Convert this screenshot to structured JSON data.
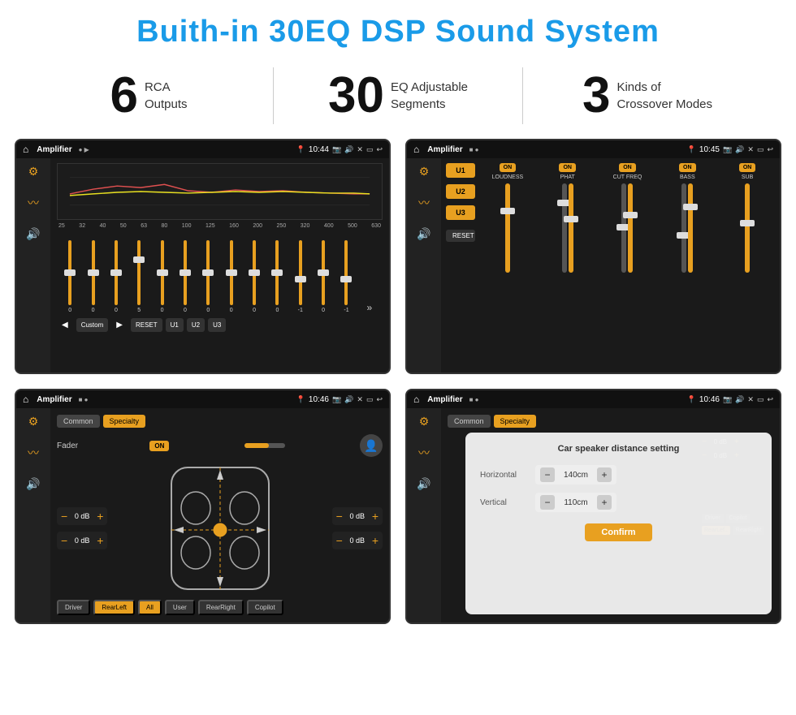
{
  "page": {
    "title": "Buith-in 30EQ DSP Sound System"
  },
  "stats": [
    {
      "number": "6",
      "label": "RCA\nOutputs"
    },
    {
      "number": "30",
      "label": "EQ Adjustable\nSegments"
    },
    {
      "number": "3",
      "label": "Kinds of\nCrossover Modes"
    }
  ],
  "screen1": {
    "app": "Amplifier",
    "time": "10:44",
    "eq_freqs": [
      "25",
      "32",
      "40",
      "50",
      "63",
      "80",
      "100",
      "125",
      "160",
      "200",
      "250",
      "320",
      "400",
      "500",
      "630"
    ],
    "eq_vals": [
      "0",
      "0",
      "0",
      "5",
      "0",
      "0",
      "0",
      "0",
      "0",
      "0",
      "0",
      "-1",
      "0",
      "-1"
    ],
    "controls": [
      "Custom",
      "RESET",
      "U1",
      "U2",
      "U3"
    ]
  },
  "screen2": {
    "app": "Amplifier",
    "time": "10:45",
    "presets": [
      "U1",
      "U2",
      "U3"
    ],
    "channels": [
      "LOUDNESS",
      "PHAT",
      "CUT FREQ",
      "BASS",
      "SUB"
    ],
    "on_labels": [
      "ON",
      "ON",
      "ON",
      "ON",
      "ON"
    ],
    "reset": "RESET"
  },
  "screen3": {
    "app": "Amplifier",
    "time": "10:46",
    "tabs": [
      "Common",
      "Specialty"
    ],
    "fader_label": "Fader",
    "fader_on": "ON",
    "ch_vals": [
      "0 dB",
      "0 dB",
      "0 dB",
      "0 dB"
    ],
    "bottom_btns": [
      "Driver",
      "RearLeft",
      "All",
      "User",
      "RearRight",
      "Copilot"
    ]
  },
  "screen4": {
    "app": "Amplifier",
    "time": "10:46",
    "tabs": [
      "Common",
      "Specialty"
    ],
    "dialog_title": "Car speaker distance setting",
    "horizontal_label": "Horizontal",
    "horizontal_val": "140cm",
    "vertical_label": "Vertical",
    "vertical_val": "110cm",
    "confirm": "Confirm",
    "ch_vals": [
      "0 dB",
      "0 dB"
    ]
  }
}
